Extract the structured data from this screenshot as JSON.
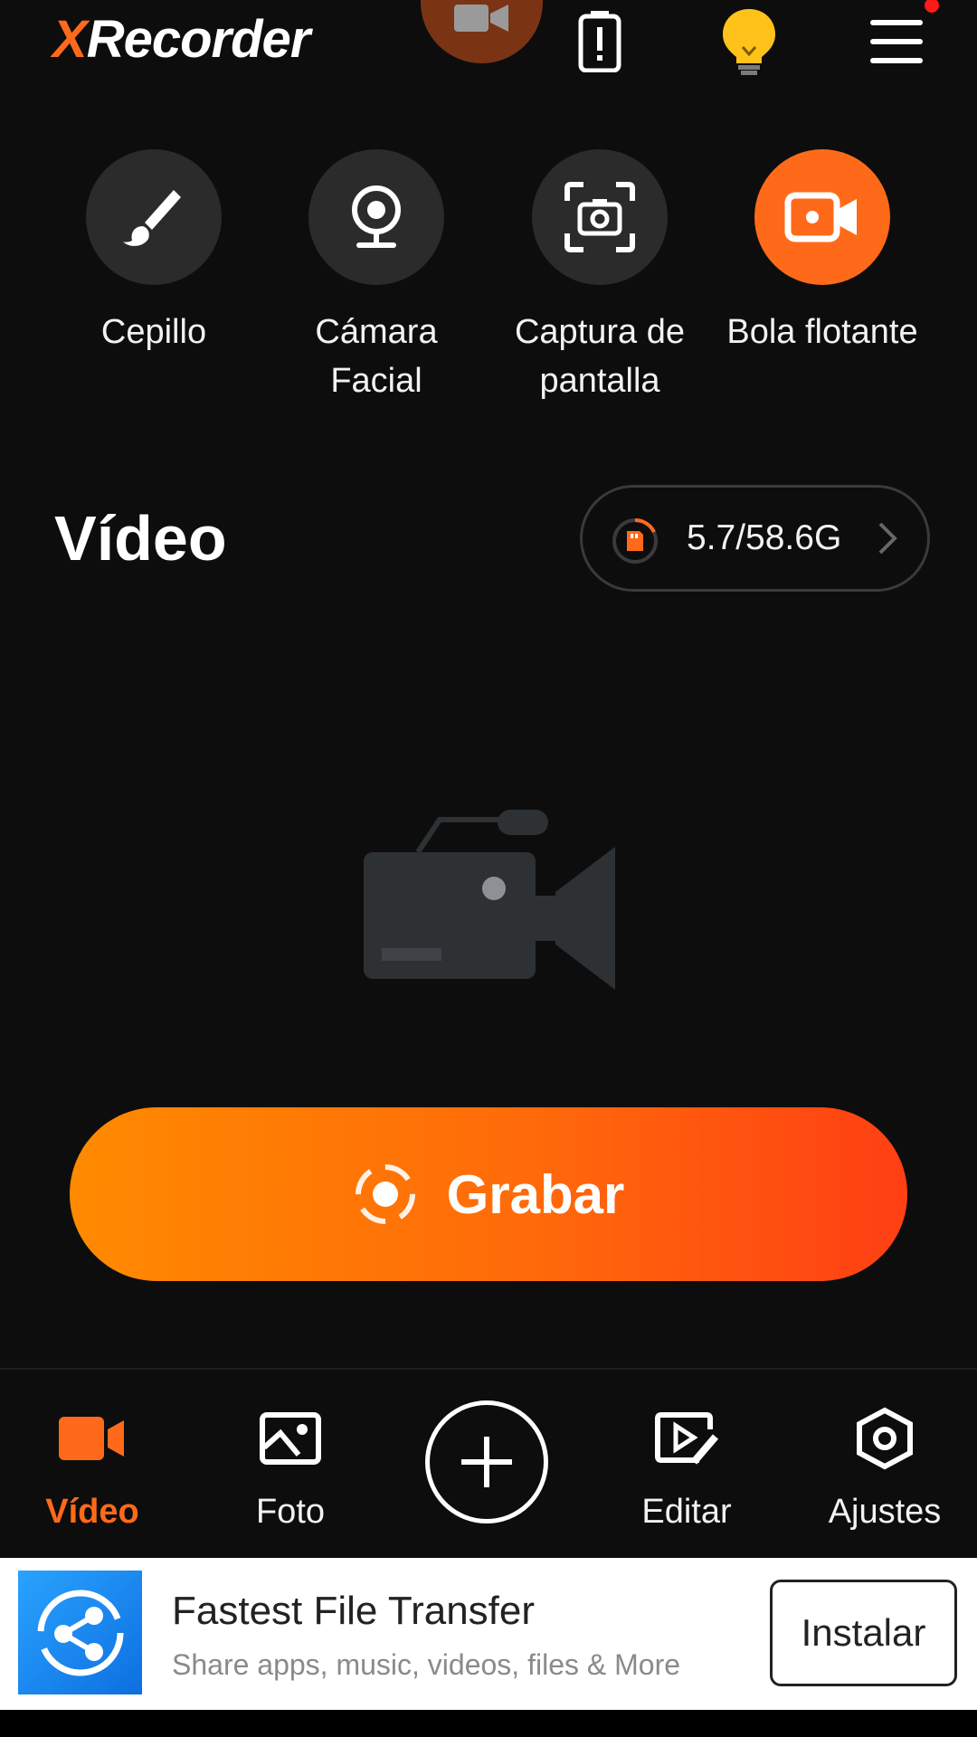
{
  "app": {
    "logo_x": "X",
    "logo_rest": "Recorder"
  },
  "colors": {
    "accent": "#ff6a1a",
    "bulb": "#ffc21a",
    "notification": "#ff1a1a"
  },
  "header": {
    "icons": [
      "battery-alert-icon",
      "lightbulb-icon",
      "menu-icon"
    ]
  },
  "tools": [
    {
      "label": "Cepillo",
      "icon": "brush-icon"
    },
    {
      "label": "Cámara Facial",
      "icon": "webcam-icon"
    },
    {
      "label": "Captura de pantalla",
      "icon": "screenshot-icon"
    },
    {
      "label": "Bola flotante",
      "icon": "floating-ball-camera-icon",
      "active": true
    }
  ],
  "section": {
    "title": "Vídeo"
  },
  "storage": {
    "text": "5.7/58.6G"
  },
  "record": {
    "label": "Grabar"
  },
  "nav": {
    "items": [
      {
        "label": "Vídeo",
        "icon": "video-icon",
        "active": true
      },
      {
        "label": "Foto",
        "icon": "photo-icon"
      },
      {
        "label": "Editar",
        "icon": "edit-icon"
      },
      {
        "label": "Ajustes",
        "icon": "settings-icon"
      }
    ]
  },
  "ad": {
    "title": "Fastest File Transfer",
    "subtitle": "Share apps, music, videos, files & More",
    "button": "Instalar"
  }
}
